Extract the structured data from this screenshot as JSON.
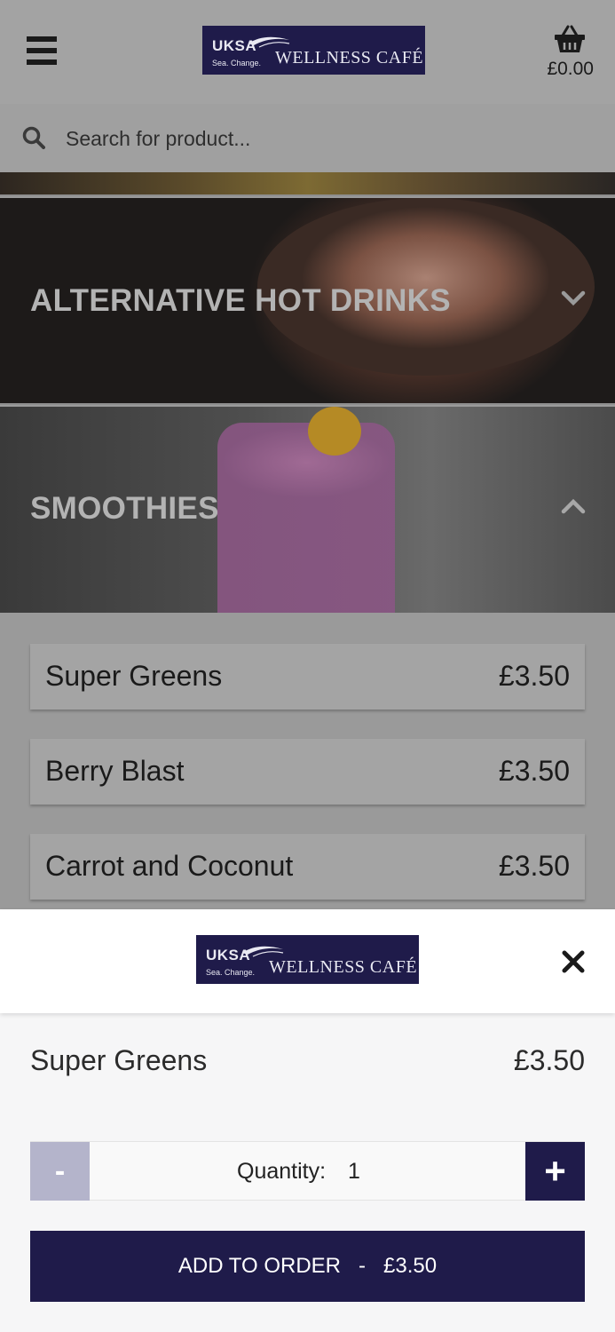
{
  "header": {
    "menu_icon": "hamburger-menu-icon",
    "logo": {
      "brand": "UKSA",
      "tagline": "Sea. Change.",
      "name": "WELLNESS CAFÉ"
    },
    "cart": {
      "icon": "basket-icon",
      "total": "£0.00"
    }
  },
  "search": {
    "icon": "search-icon",
    "placeholder": "Search for product..."
  },
  "categories": [
    {
      "title": "ALTERNATIVE HOT DRINKS",
      "state": "collapsed",
      "icon": "chevron-down-icon"
    },
    {
      "title": "SMOOTHIES",
      "state": "expanded",
      "icon": "chevron-up-icon"
    }
  ],
  "products": [
    {
      "name": "Super Greens",
      "price": "£3.50"
    },
    {
      "name": "Berry Blast",
      "price": "£3.50"
    },
    {
      "name": "Carrot and Coconut",
      "price": "£3.50"
    }
  ],
  "sheet": {
    "logo": {
      "brand": "UKSA",
      "tagline": "Sea. Change.",
      "name": "WELLNESS CAFÉ"
    },
    "close_icon": "close-icon",
    "item": {
      "name": "Super Greens",
      "price": "£3.50"
    },
    "quantity": {
      "minus": "-",
      "plus": "+",
      "label": "Quantity:",
      "value": "1"
    },
    "add_button": {
      "label": "ADD TO ORDER",
      "separator": "-",
      "price": "£3.50"
    }
  },
  "colors": {
    "brand_navy": "#1f1b4a",
    "minus_disabled": "#b4b4cb",
    "overlay_grey": "#9a9a9a"
  }
}
